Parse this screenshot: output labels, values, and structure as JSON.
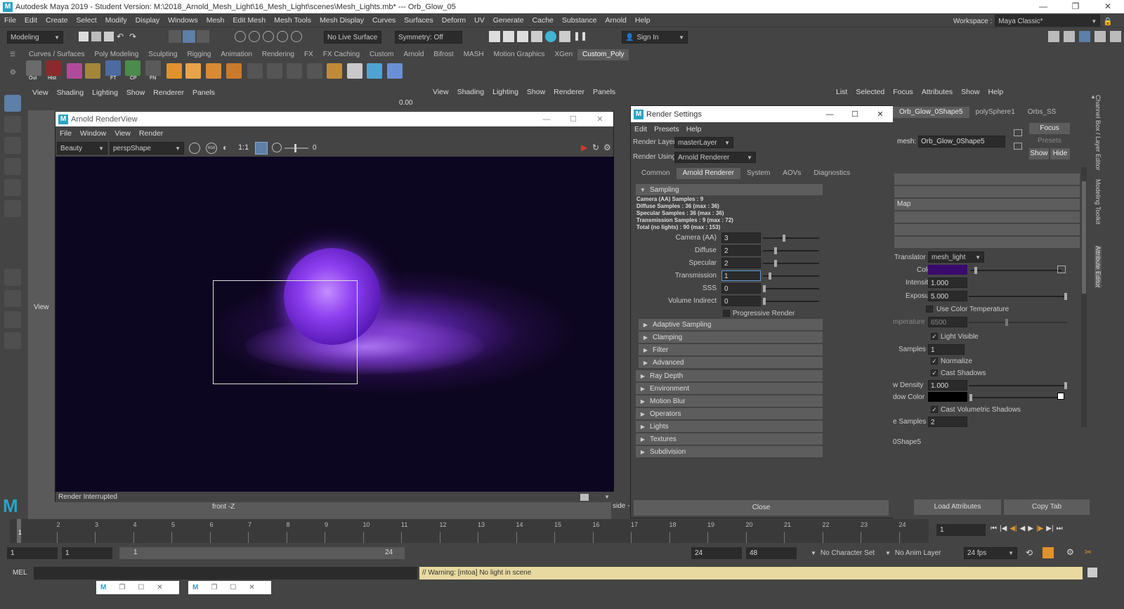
{
  "window": {
    "title": "Autodesk Maya 2019 - Student Version: M:\\2018_Arnold_Mesh_Light\\16_Mesh_Light\\scenes\\Mesh_Lights.mb*   ---   Orb_Glow_05",
    "logo": "M",
    "minimize": "—",
    "maximize": "❐",
    "close": "✕"
  },
  "menubar": [
    "File",
    "Edit",
    "Create",
    "Select",
    "Modify",
    "Display",
    "Windows",
    "Mesh",
    "Edit Mesh",
    "Mesh Tools",
    "Mesh Display",
    "Curves",
    "Surfaces",
    "Deform",
    "UV",
    "Generate",
    "Cache",
    "Substance",
    "Arnold",
    "Help"
  ],
  "workspace": {
    "label": "Workspace :",
    "value": "Maya Classic*"
  },
  "statusline": {
    "menuset": "Modeling",
    "live_surface": "No Live Surface",
    "symmetry": "Symmetry: Off",
    "sign_in": "Sign In"
  },
  "shelf_tabs": [
    "Curves / Surfaces",
    "Poly Modeling",
    "Sculpting",
    "Rigging",
    "Animation",
    "Rendering",
    "FX",
    "FX Caching",
    "Custom",
    "Arnold",
    "Bifrost",
    "MASH",
    "Motion Graphics",
    "XGen",
    "Custom_Poly"
  ],
  "shelf_active": "Custom_Poly",
  "shelf_labels": [
    "Out",
    "Hist",
    "FT",
    "CP",
    "FN"
  ],
  "viewport_left": {
    "menu": [
      "View",
      "Shading",
      "Lighting",
      "Show",
      "Renderer",
      "Panels"
    ],
    "value": "0.00",
    "view_label": "View",
    "camera": "front -Z"
  },
  "viewport_right": {
    "menu": [
      "View",
      "Shading",
      "Lighting",
      "Show",
      "Renderer",
      "Panels"
    ],
    "value": "0.00",
    "camera": "side -"
  },
  "renderview": {
    "title": "Arnold RenderView",
    "logo": "M",
    "menu": [
      "File",
      "Window",
      "View",
      "Render"
    ],
    "aov": "Beauty",
    "camera": "perspShape",
    "ratio": "1:1",
    "exposure": "0",
    "status": "Render Interrupted",
    "rgb": "RGB"
  },
  "render_settings": {
    "title": "Render Settings",
    "logo": "M",
    "menu": [
      "Edit",
      "Presets",
      "Help"
    ],
    "render_layer_label": "Render Layer",
    "render_layer": "masterLayer",
    "render_using_label": "Render Using",
    "render_using": "Arnold Renderer",
    "tabs": [
      "Common",
      "Arnold Renderer",
      "System",
      "AOVs",
      "Diagnostics"
    ],
    "active_tab": "Arnold Renderer",
    "sampling_title": "Sampling",
    "summary": [
      "Camera (AA) Samples : 9",
      "Diffuse Samples : 36 (max : 36)",
      "Specular Samples : 36 (max : 36)",
      "Transmission Samples : 9 (max : 72)",
      "Total (no lights) : 90 (max : 153)"
    ],
    "fields": [
      {
        "label": "Camera (AA)",
        "value": "3",
        "level": 0.35
      },
      {
        "label": "Diffuse",
        "value": "2",
        "level": 0.2
      },
      {
        "label": "Specular",
        "value": "2",
        "level": 0.2
      },
      {
        "label": "Transmission",
        "value": "1",
        "level": 0.1
      },
      {
        "label": "SSS",
        "value": "0",
        "level": 0.0
      },
      {
        "label": "Volume Indirect",
        "value": "0",
        "level": 0.0
      }
    ],
    "progressive": "Progressive Render",
    "sampling_sub": [
      "Adaptive Sampling",
      "Clamping",
      "Filter",
      "Advanced"
    ],
    "sections": [
      "Ray Depth",
      "Environment",
      "Motion Blur",
      "Operators",
      "Lights",
      "Textures",
      "Subdivision"
    ],
    "close": "Close"
  },
  "attribute_editor": {
    "menu": [
      "List",
      "Selected",
      "Focus",
      "Attributes",
      "Show",
      "Help"
    ],
    "tabs": [
      "Orb_Glow_0Shape5",
      "polySphere1",
      "Orbs_SS"
    ],
    "mesh_label": "mesh:",
    "mesh_value": "Orb_Glow_0Shape5",
    "focus": "Focus",
    "presets": "Presets",
    "show": "Show",
    "hide": "Hide",
    "map_label": "Map",
    "translator_label": "Translator",
    "translator": "mesh_light",
    "color_label": "Color",
    "color": "#3a0a6e",
    "intensity_label": "Intensity",
    "intensity": "1.000",
    "exposure_label": "Exposure",
    "exposure": "5.000",
    "use_color_temp": "Use Color Temperature",
    "temperature_label": "mperature",
    "temperature": "6500",
    "light_visible": "Light Visible",
    "samples_label": "Samples",
    "samples": "1",
    "normalize": "Normalize",
    "cast_shadows": "Cast Shadows",
    "shadow_density_label": "w Density",
    "shadow_density": "1.000",
    "shadow_color_label": "dow Color",
    "cast_vol_shadows": "Cast Volumetric Shadows",
    "vol_samples_label": "e Samples",
    "vol_samples": "2",
    "footer_node": "0Shape5",
    "load_attributes": "Load Attributes",
    "copy_tab": "Copy Tab"
  },
  "side_tabs": [
    "Channel Box / Layer Editor",
    "Modeling Toolkit",
    "Attribute Editor"
  ],
  "timeline": {
    "ticks": [
      "1",
      "2",
      "3",
      "4",
      "5",
      "6",
      "7",
      "8",
      "9",
      "10",
      "11",
      "12",
      "13",
      "14",
      "15",
      "16",
      "17",
      "18",
      "19",
      "20",
      "21",
      "22",
      "23",
      "24"
    ],
    "current": "1"
  },
  "range": {
    "start": "1",
    "inner_start": "1",
    "slider_start": "1",
    "slider_end": "24",
    "end": "24",
    "outer_end": "48",
    "character_set": "No Character Set",
    "anim_layer": "No Anim Layer",
    "fps": "24 fps"
  },
  "cmdline": {
    "lang": "MEL",
    "warning": "// Warning: [mtoa] No light in scene"
  }
}
